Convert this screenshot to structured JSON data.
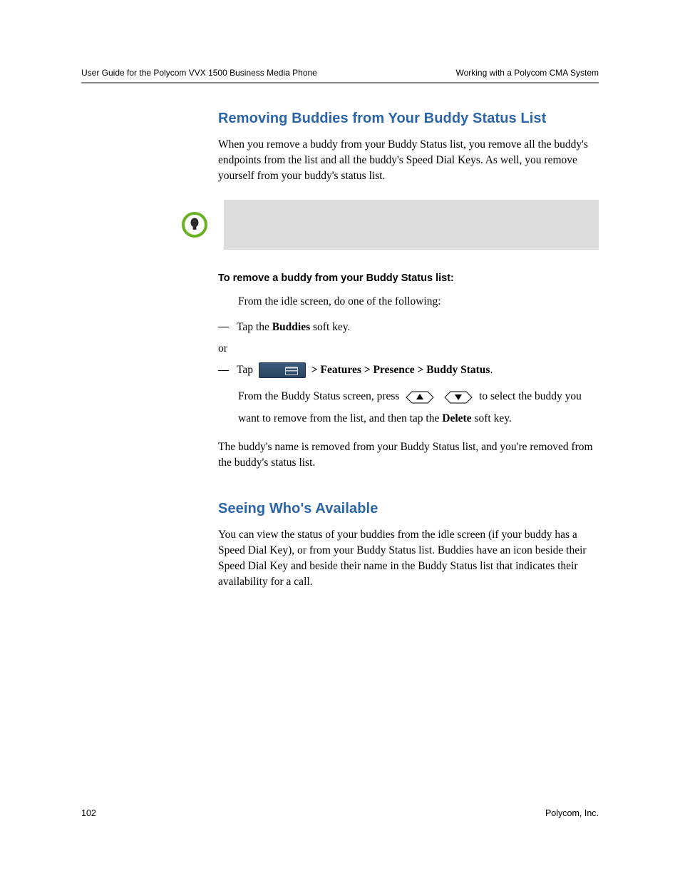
{
  "header": {
    "left": "User Guide for the Polycom VVX 1500 Business Media Phone",
    "right": "Working with a Polycom CMA System"
  },
  "sec1": {
    "title": "Removing Buddies from Your Buddy Status List",
    "intro": "When you remove a buddy from your Buddy Status list, you remove all the buddy's endpoints from the list and all the buddy's Speed Dial Keys. As well, you remove yourself from your buddy's status list.",
    "subhead": "To remove a buddy from your Buddy Status list:",
    "step_intro": "From the idle screen, do one of the following:",
    "bullet1_prefix": "Tap the ",
    "bullet1_bold": "Buddies",
    "bullet1_suffix": " soft key.",
    "or": "or",
    "bullet2_prefix": "Tap ",
    "bullet2_path": " > Features > Presence > Buddy Status",
    "bullet2_suffix": ".",
    "step2_prefix": "From the Buddy Status screen, press ",
    "step2_mid": " to select the buddy you want to remove from the list, and then tap the ",
    "step2_bold": "Delete",
    "step2_suffix": " soft key.",
    "outro": "The buddy's name is removed from your Buddy Status list, and you're removed from the buddy's status list."
  },
  "sec2": {
    "title": "Seeing Who's Available",
    "body": "You can view the status of your buddies from the idle screen (if your buddy has a Speed Dial Key), or from your Buddy Status list. Buddies have an icon beside their Speed Dial Key and beside their name in the Buddy Status list that indicates their availability for a call."
  },
  "footer": {
    "page": "102",
    "company": "Polycom, Inc."
  }
}
